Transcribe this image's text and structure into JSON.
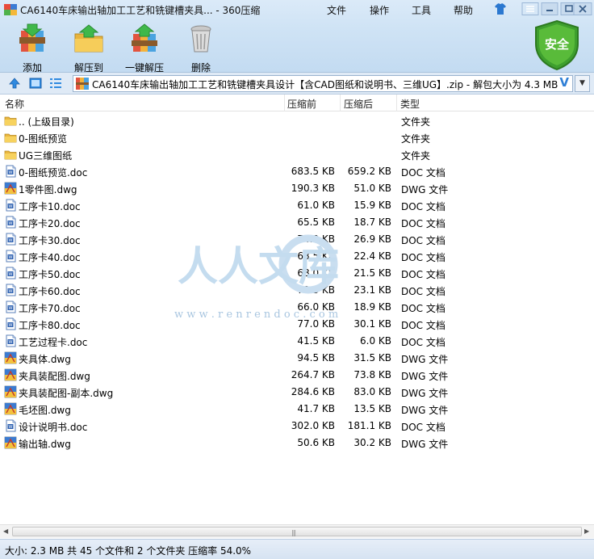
{
  "window": {
    "title": "CA6140车床输出轴加工工艺和铣键槽夹具... - 360压缩",
    "menu": [
      "文件",
      "操作",
      "工具",
      "帮助"
    ]
  },
  "toolbar": {
    "add": "添加",
    "extract_to": "解压到",
    "one_click_extract": "一键解压",
    "delete": "删除",
    "security_badge": "安全"
  },
  "address": {
    "path": "CA6140车床输出轴加工工艺和铣键槽夹具设计【含CAD图纸和说明书、三维UG】.zip - 解包大小为 4.3 MB",
    "badge": "V"
  },
  "columns": {
    "name": "名称",
    "compressed": "压缩前",
    "uncompressed": "压缩后",
    "type": "类型"
  },
  "files": [
    {
      "name": ".. (上级目录)",
      "before": "",
      "after": "",
      "type": "文件夹",
      "icon": "folder-icon"
    },
    {
      "name": "0-图纸预览",
      "before": "",
      "after": "",
      "type": "文件夹",
      "icon": "folder-icon"
    },
    {
      "name": "UG三维图纸",
      "before": "",
      "after": "",
      "type": "文件夹",
      "icon": "folder-icon"
    },
    {
      "name": "0-图纸预览.doc",
      "before": "683.5 KB",
      "after": "659.2 KB",
      "type": "DOC 文档",
      "icon": "doc-icon"
    },
    {
      "name": "1零件图.dwg",
      "before": "190.3 KB",
      "after": "51.0 KB",
      "type": "DWG 文件",
      "icon": "dwg-icon"
    },
    {
      "name": "工序卡10.doc",
      "before": "61.0 KB",
      "after": "15.9 KB",
      "type": "DOC 文档",
      "icon": "doc-icon"
    },
    {
      "name": "工序卡20.doc",
      "before": "65.5 KB",
      "after": "18.7 KB",
      "type": "DOC 文档",
      "icon": "doc-icon"
    },
    {
      "name": "工序卡30.doc",
      "before": "74.0 KB",
      "after": "26.9 KB",
      "type": "DOC 文档",
      "icon": "doc-icon"
    },
    {
      "name": "工序卡40.doc",
      "before": "68.5 KB",
      "after": "22.4 KB",
      "type": "DOC 文档",
      "icon": "doc-icon"
    },
    {
      "name": "工序卡50.doc",
      "before": "68.0 KB",
      "after": "21.5 KB",
      "type": "DOC 文档",
      "icon": "doc-icon"
    },
    {
      "name": "工序卡60.doc",
      "before": "70.5 KB",
      "after": "23.1 KB",
      "type": "DOC 文档",
      "icon": "doc-icon"
    },
    {
      "name": "工序卡70.doc",
      "before": "66.0 KB",
      "after": "18.9 KB",
      "type": "DOC 文档",
      "icon": "doc-icon"
    },
    {
      "name": "工序卡80.doc",
      "before": "77.0 KB",
      "after": "30.1 KB",
      "type": "DOC 文档",
      "icon": "doc-icon"
    },
    {
      "name": "工艺过程卡.doc",
      "before": "41.5 KB",
      "after": "6.0 KB",
      "type": "DOC 文档",
      "icon": "doc-icon"
    },
    {
      "name": "夹具体.dwg",
      "before": "94.5 KB",
      "after": "31.5 KB",
      "type": "DWG 文件",
      "icon": "dwg-icon"
    },
    {
      "name": "夹具装配图.dwg",
      "before": "264.7 KB",
      "after": "73.8 KB",
      "type": "DWG 文件",
      "icon": "dwg-icon"
    },
    {
      "name": "夹具装配图-副本.dwg",
      "before": "284.6 KB",
      "after": "83.0 KB",
      "type": "DWG 文件",
      "icon": "dwg-icon"
    },
    {
      "name": "毛坯图.dwg",
      "before": "41.7 KB",
      "after": "13.5 KB",
      "type": "DWG 文件",
      "icon": "dwg-icon"
    },
    {
      "name": "设计说明书.doc",
      "before": "302.0 KB",
      "after": "181.1 KB",
      "type": "DOC 文档",
      "icon": "doc-icon"
    },
    {
      "name": "输出轴.dwg",
      "before": "50.6 KB",
      "after": "30.2 KB",
      "type": "DWG 文件",
      "icon": "dwg-icon"
    }
  ],
  "watermark": {
    "text": "人人文库",
    "url": "w w w . r e n r e n d o c . c o m"
  },
  "status": "大小: 2.3 MB 共 45 个文件和 2 个文件夹 压缩率 54.0%"
}
